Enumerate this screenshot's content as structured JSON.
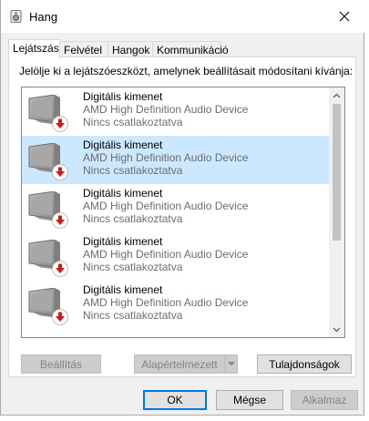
{
  "window": {
    "title": "Hang",
    "close_icon": "close-icon",
    "app_icon": "speaker-icon"
  },
  "tabs": [
    {
      "label": "Lejátszás",
      "active": true
    },
    {
      "label": "Felvétel",
      "active": false
    },
    {
      "label": "Hangok",
      "active": false
    },
    {
      "label": "Kommunikáció",
      "active": false
    }
  ],
  "instruction": "Jelölje ki a lejátszóeszközt, amelynek beállításait módosítani kívánja:",
  "devices": [
    {
      "name": "Digitális kimenet",
      "description": "AMD High Definition Audio Device",
      "status": "Nincs csatlakoztatva",
      "selected": false
    },
    {
      "name": "Digitális kimenet",
      "description": "AMD High Definition Audio Device",
      "status": "Nincs csatlakoztatva",
      "selected": true
    },
    {
      "name": "Digitális kimenet",
      "description": "AMD High Definition Audio Device",
      "status": "Nincs csatlakoztatva",
      "selected": false
    },
    {
      "name": "Digitális kimenet",
      "description": "AMD High Definition Audio Device",
      "status": "Nincs csatlakoztatva",
      "selected": false
    },
    {
      "name": "Digitális kimenet",
      "description": "AMD High Definition Audio Device",
      "status": "Nincs csatlakoztatva",
      "selected": false
    }
  ],
  "device_icon": "monitor-icon",
  "status_badge_icon": "disconnected-arrow-icon",
  "buttons": {
    "configure": "Beállítás",
    "set_default": "Alapértelmezett",
    "properties": "Tulajdonságok",
    "ok": "OK",
    "cancel": "Mégse",
    "apply": "Alkalmaz"
  },
  "colors": {
    "selection": "#cce8ff",
    "badge_red": "#d21919",
    "focus_blue": "#0078d7"
  }
}
